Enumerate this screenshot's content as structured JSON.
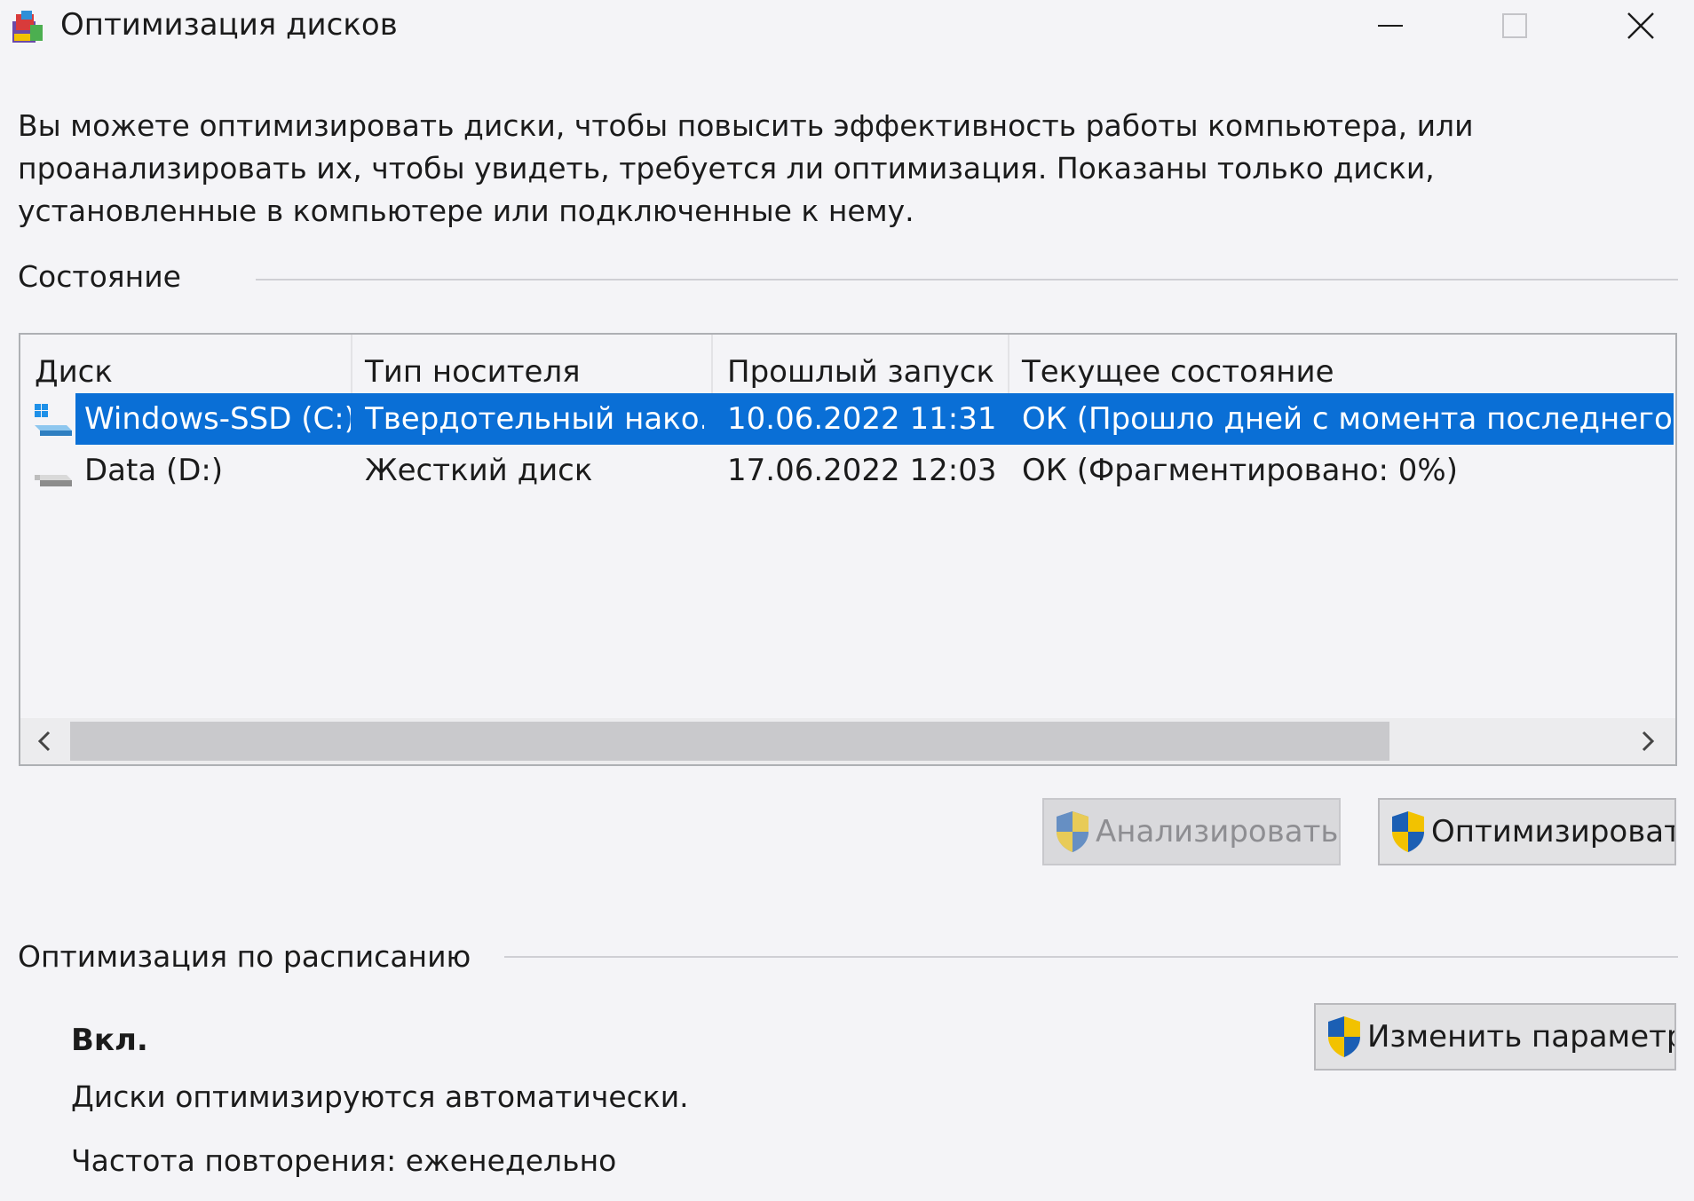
{
  "window": {
    "title": "Оптимизация дисков",
    "icons": {
      "app": "disk-optimize-icon",
      "minimize": "minimize-icon",
      "maximize": "maximize-icon",
      "close": "close-icon"
    }
  },
  "description": "Вы можете оптимизировать диски, чтобы повысить эффективность работы  компьютера, или\nпроанализировать их, чтобы увидеть, требуется ли оптимизация. Показаны только диски,\nустановленные в компьютере или подключенные к нему.",
  "status": {
    "title": "Состояние",
    "columns": [
      "Диск",
      "Тип носителя",
      "Прошлый запуск",
      "Текущее состояние"
    ],
    "rows": [
      {
        "disk": "Windows-SSD (C:)",
        "media": "Твердотельный нако...",
        "last_run": "10.06.2022 11:31",
        "state": "ОК (Прошло дней с момента последнего за",
        "selected": true,
        "icon": "windows-ssd-drive-icon"
      },
      {
        "disk": "Data (D:)",
        "media": "Жесткий диск",
        "last_run": "17.06.2022 12:03",
        "state": "ОК (Фрагментировано: 0%)",
        "selected": false,
        "icon": "hard-drive-icon"
      }
    ]
  },
  "actions": {
    "analyze_label": "Анализировать",
    "optimize_label": "Оптимизировать"
  },
  "schedule": {
    "title": "Оптимизация по расписанию",
    "state": "Вкл.",
    "info": "Диски оптимизируются автоматически.",
    "frequency": "Частота повторения: еженедельно",
    "change_label": "Изменить параметры"
  },
  "colors": {
    "selection": "#0a6fd6",
    "background": "#f4f4f7",
    "shield_blue": "#1b5fb4",
    "shield_yellow": "#f2c200"
  }
}
